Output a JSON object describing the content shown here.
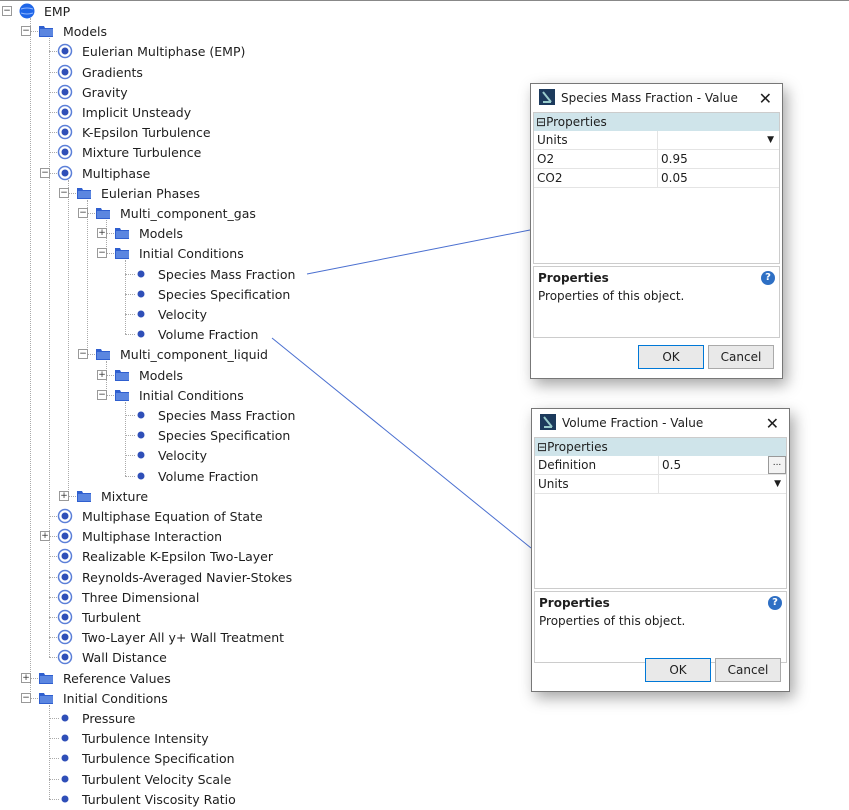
{
  "tree": [
    {
      "label": "EMP",
      "level": 0,
      "icon": "globe",
      "exp": "minus"
    },
    {
      "label": "Models",
      "level": 1,
      "icon": "folder",
      "exp": "minus"
    },
    {
      "label": "Eulerian Multiphase (EMP)",
      "level": 2,
      "icon": "model"
    },
    {
      "label": "Gradients",
      "level": 2,
      "icon": "model"
    },
    {
      "label": "Gravity",
      "level": 2,
      "icon": "model"
    },
    {
      "label": "Implicit Unsteady",
      "level": 2,
      "icon": "model"
    },
    {
      "label": "K-Epsilon Turbulence",
      "level": 2,
      "icon": "model"
    },
    {
      "label": "Mixture Turbulence",
      "level": 2,
      "icon": "model"
    },
    {
      "label": "Multiphase",
      "level": 2,
      "icon": "model",
      "exp": "minus"
    },
    {
      "label": "Eulerian Phases",
      "level": 3,
      "icon": "folder",
      "exp": "minus"
    },
    {
      "label": "Multi_component_gas",
      "level": 4,
      "icon": "folder",
      "exp": "minus"
    },
    {
      "label": "Models",
      "level": 5,
      "icon": "folder",
      "exp": "plus"
    },
    {
      "label": "Initial Conditions",
      "level": 5,
      "icon": "folder",
      "exp": "minus"
    },
    {
      "label": "Species Mass Fraction",
      "level": 6,
      "icon": "dot"
    },
    {
      "label": "Species Specification",
      "level": 6,
      "icon": "dot"
    },
    {
      "label": "Velocity",
      "level": 6,
      "icon": "dot"
    },
    {
      "label": "Volume Fraction",
      "level": 6,
      "icon": "dot"
    },
    {
      "label": "Multi_component_liquid",
      "level": 4,
      "icon": "folder",
      "exp": "minus"
    },
    {
      "label": "Models",
      "level": 5,
      "icon": "folder",
      "exp": "plus"
    },
    {
      "label": "Initial Conditions",
      "level": 5,
      "icon": "folder",
      "exp": "minus"
    },
    {
      "label": "Species Mass Fraction",
      "level": 6,
      "icon": "dot"
    },
    {
      "label": "Species Specification",
      "level": 6,
      "icon": "dot"
    },
    {
      "label": "Velocity",
      "level": 6,
      "icon": "dot"
    },
    {
      "label": "Volume Fraction",
      "level": 6,
      "icon": "dot"
    },
    {
      "label": "Mixture",
      "level": 3,
      "icon": "folder",
      "exp": "plus"
    },
    {
      "label": "Multiphase Equation of State",
      "level": 2,
      "icon": "model"
    },
    {
      "label": "Multiphase Interaction",
      "level": 2,
      "icon": "model",
      "exp": "plus"
    },
    {
      "label": "Realizable K-Epsilon Two-Layer",
      "level": 2,
      "icon": "model"
    },
    {
      "label": "Reynolds-Averaged Navier-Stokes",
      "level": 2,
      "icon": "model"
    },
    {
      "label": "Three Dimensional",
      "level": 2,
      "icon": "model"
    },
    {
      "label": "Turbulent",
      "level": 2,
      "icon": "model"
    },
    {
      "label": "Two-Layer All y+ Wall Treatment",
      "level": 2,
      "icon": "model"
    },
    {
      "label": "Wall Distance",
      "level": 2,
      "icon": "model"
    },
    {
      "label": "Reference Values",
      "level": 1,
      "icon": "folder",
      "exp": "plus"
    },
    {
      "label": "Initial Conditions",
      "level": 1,
      "icon": "folder",
      "exp": "minus"
    },
    {
      "label": "Pressure",
      "level": 2,
      "icon": "dot"
    },
    {
      "label": "Turbulence Intensity",
      "level": 2,
      "icon": "dot"
    },
    {
      "label": "Turbulence Specification",
      "level": 2,
      "icon": "dot"
    },
    {
      "label": "Turbulent Velocity Scale",
      "level": 2,
      "icon": "dot"
    },
    {
      "label": "Turbulent Viscosity Ratio",
      "level": 2,
      "icon": "dot"
    }
  ],
  "dialog1": {
    "title": "Species Mass Fraction - Value",
    "section": "Properties",
    "rows": [
      {
        "k": "Units",
        "v": "",
        "dropdown": true
      },
      {
        "k": "O2",
        "v": "0.95"
      },
      {
        "k": "CO2",
        "v": "0.05"
      }
    ],
    "desc_title": "Properties",
    "desc": "Properties of this object.",
    "ok": "OK",
    "cancel": "Cancel"
  },
  "dialog2": {
    "title": "Volume Fraction - Value",
    "section": "Properties",
    "rows": [
      {
        "k": "Definition",
        "v": "0.5",
        "ellipsis": true
      },
      {
        "k": "Units",
        "v": "",
        "dropdown": true
      }
    ],
    "desc_title": "Properties",
    "desc": "Properties of this object.",
    "ok": "OK",
    "cancel": "Cancel"
  },
  "colors": {
    "accent": "#2f5fcf",
    "header": "#cfe4ea",
    "line": "#4a6fd0"
  }
}
